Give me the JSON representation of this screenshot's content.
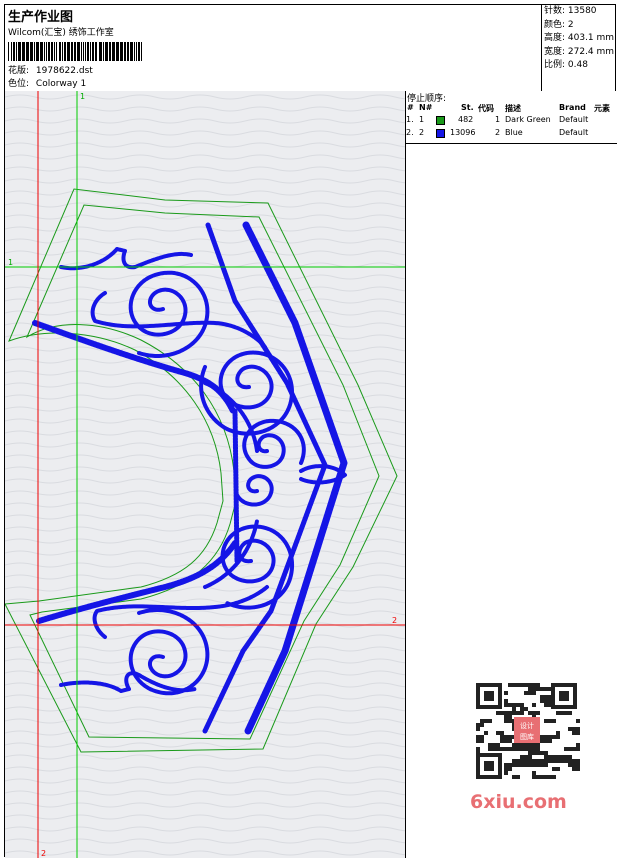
{
  "header": {
    "title": "生产作业图",
    "subtitle": "Wilcom(汇宝) 绣饰工作室",
    "design_label": "花版:",
    "design_value": "1978622.dst",
    "colorway_label": "色位:",
    "colorway_value": "Colorway 1"
  },
  "stats": {
    "stitches": "针数: 13580",
    "colors": "颜色: 2",
    "height": "高度: 403.1 mm",
    "width": "宽度: 272.4 mm",
    "scale": "比例: 0.48"
  },
  "stop_sequence": {
    "title": "停止顺序:",
    "headers": [
      "#",
      "N#",
      "St.",
      "代码",
      "描述",
      "Brand",
      "元素"
    ],
    "rows": [
      {
        "index": "1.",
        "needle": "1",
        "color": "#1a9a1a",
        "stitches": "482",
        "code": "1",
        "description": "Dark Green",
        "brand": "Default"
      },
      {
        "index": "2.",
        "needle": "2",
        "color": "#1515e6",
        "stitches": "13096",
        "code": "2",
        "description": "Blue",
        "brand": "Default"
      }
    ]
  },
  "guides": {
    "h1": "1",
    "h2": "2",
    "v1": "1",
    "v2": "2",
    "line_green": "#00cc00",
    "line_red": "#ee0000"
  },
  "design_colors": {
    "outline": "#1a9a1a",
    "fill": "#1515e6"
  },
  "watermark": {
    "site": "6xiu.com",
    "stamp": "设计图库"
  }
}
